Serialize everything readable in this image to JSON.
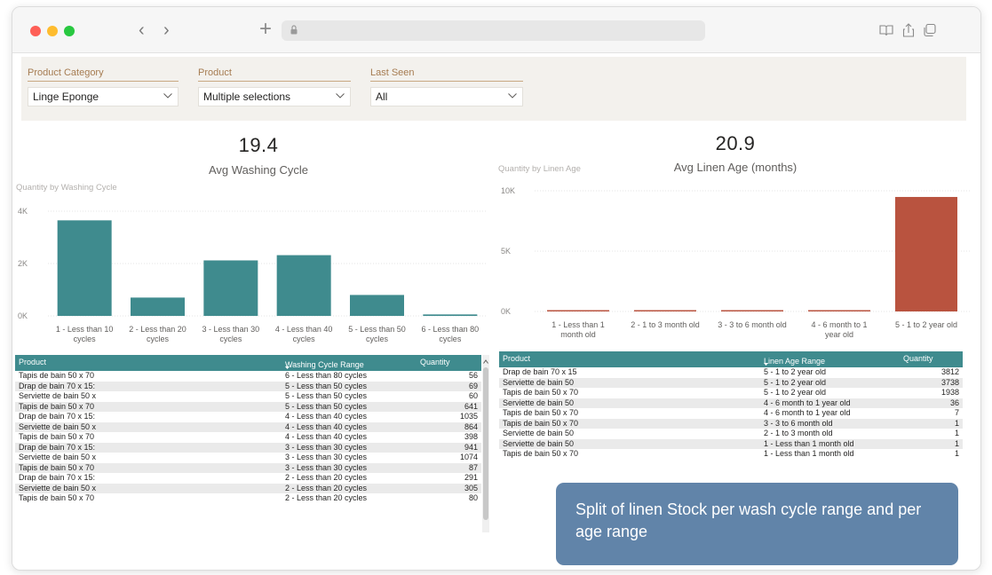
{
  "filters": [
    {
      "label": "Product Category",
      "value": "Linge Eponge"
    },
    {
      "label": "Product",
      "value": "Multiple selections"
    },
    {
      "label": "Last Seen",
      "value": "All"
    }
  ],
  "kpis": {
    "left": {
      "value": "19.4",
      "label": "Avg Washing Cycle"
    },
    "right": {
      "value": "20.9",
      "label": "Avg Linen Age (months)"
    }
  },
  "chart_data": [
    {
      "type": "bar",
      "title": "Quantity by Washing Cycle",
      "categories": [
        [
          "1 - Less than 10",
          "cycles"
        ],
        [
          "2 - Less than 20",
          "cycles"
        ],
        [
          "3 - Less than 30",
          "cycles"
        ],
        [
          "4 - Less than 40",
          "cycles"
        ],
        [
          "5 - Less than 50",
          "cycles"
        ],
        [
          "6 - Less than 80",
          "cycles"
        ]
      ],
      "values": [
        3650,
        700,
        2120,
        2320,
        800,
        56
      ],
      "ylim": [
        0,
        4000
      ],
      "yticks": [
        0,
        2000,
        4000
      ],
      "ytick_labels": [
        "0K",
        "2K",
        "4K"
      ],
      "color": "#3f8b8e",
      "grid": true
    },
    {
      "type": "bar",
      "title": "Quantity by Linen Age",
      "categories": [
        [
          "1 - Less than 1",
          "month old"
        ],
        [
          "2 - 1 to 3 month old"
        ],
        [
          "3 - 3 to 6 month old"
        ],
        [
          "4 - 6 month to 1",
          "year old"
        ],
        [
          "5 - 1 to 2 year old"
        ]
      ],
      "values": [
        2,
        1,
        1,
        43,
        9488
      ],
      "ylim": [
        0,
        10000
      ],
      "yticks": [
        0,
        5000,
        10000
      ],
      "ytick_labels": [
        "0K",
        "5K",
        "10K"
      ],
      "color": "#b9533f",
      "grid": true
    }
  ],
  "table_left": {
    "columns": [
      "Product",
      "Washing Cycle Range",
      "Quantity"
    ],
    "rows": [
      [
        "Tapis de bain 50 x 70",
        "6 - Less than 80 cycles",
        "56"
      ],
      [
        "Drap de bain 70 x 15:",
        "5 - Less than 50 cycles",
        "69"
      ],
      [
        "Serviette de bain 50 x",
        "5 - Less than 50 cycles",
        "60"
      ],
      [
        "Tapis de bain 50 x 70",
        "5 - Less than 50 cycles",
        "641"
      ],
      [
        "Drap de bain 70 x 15:",
        "4 - Less than 40 cycles",
        "1035"
      ],
      [
        "Serviette de bain 50 x",
        "4 - Less than 40 cycles",
        "864"
      ],
      [
        "Tapis de bain 50 x 70",
        "4 - Less than 40 cycles",
        "398"
      ],
      [
        "Drap de bain 70 x 15:",
        "3 - Less than 30 cycles",
        "941"
      ],
      [
        "Serviette de bain 50 x",
        "3 - Less than 30 cycles",
        "1074"
      ],
      [
        "Tapis de bain 50 x 70",
        "3 - Less than 30 cycles",
        "87"
      ],
      [
        "Drap de bain 70 x 15:",
        "2 - Less than 20 cycles",
        "291"
      ],
      [
        "Serviette de bain 50 x",
        "2 - Less than 20 cycles",
        "305"
      ],
      [
        "Tapis de bain 50 x 70",
        "2 - Less than 20 cycles",
        "80"
      ]
    ]
  },
  "table_right": {
    "columns": [
      "Product",
      "Linen Age Range",
      "Quantity"
    ],
    "rows": [
      [
        "Drap de bain 70 x 15",
        "5 - 1 to 2 year old",
        "3812"
      ],
      [
        "Serviette de bain 50",
        "5 - 1 to 2 year old",
        "3738"
      ],
      [
        "Tapis de bain 50 x 70",
        "5 - 1 to 2 year old",
        "1938"
      ],
      [
        "Serviette de bain 50",
        "4 - 6 month to 1 year old",
        "36"
      ],
      [
        "Tapis de bain 50 x 70",
        "4 - 6 month to 1 year old",
        "7"
      ],
      [
        "Tapis de bain 50 x 70",
        "3 - 3 to 6 month old",
        "1"
      ],
      [
        "Serviette de bain 50",
        "2 - 1 to 3 month old",
        "1"
      ],
      [
        "Serviette de bain 50",
        "1 - Less than 1 month old",
        "1"
      ],
      [
        "Tapis de bain 50 x 70",
        "1 - Less than 1 month old",
        "1"
      ]
    ]
  },
  "callout": "Split of linen Stock per wash cycle range and per age range",
  "icons": {
    "back": "chevron-left-icon",
    "forward": "chevron-right-icon",
    "new_tab": "plus-icon",
    "lock": "lock-icon",
    "reader": "book-icon",
    "share": "share-icon",
    "tabs": "tabs-icon"
  },
  "colors": {
    "teal": "#3f8b8e",
    "rust": "#b9533f",
    "callout": "#5b7fa6",
    "filter_label": "#a67c52"
  }
}
